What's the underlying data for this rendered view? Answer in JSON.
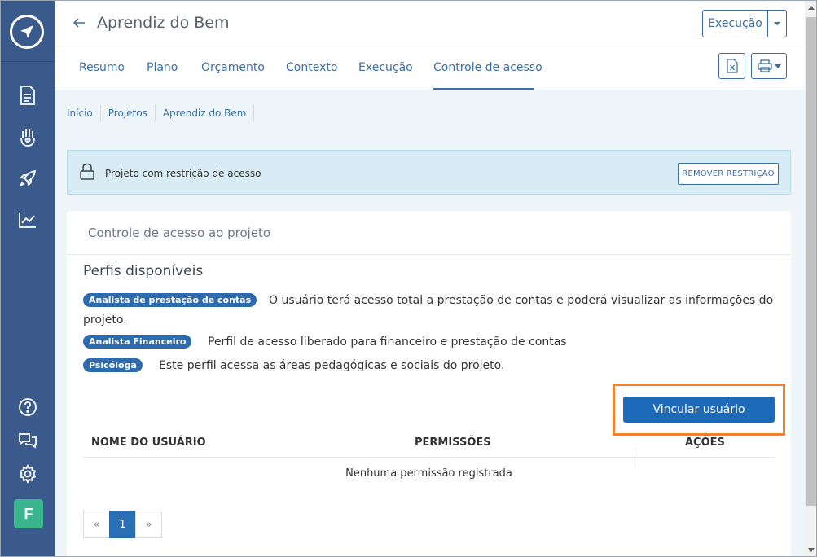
{
  "header": {
    "title": "Aprendiz do Bem",
    "execucao_label": "Execução"
  },
  "tabs": [
    {
      "label": "Resumo"
    },
    {
      "label": "Plano"
    },
    {
      "label": "Orçamento"
    },
    {
      "label": "Contexto"
    },
    {
      "label": "Execução"
    },
    {
      "label": "Controle de acesso",
      "active": true
    }
  ],
  "breadcrumb": [
    "Início",
    "Projetos",
    "Aprendiz do Bem"
  ],
  "alert": {
    "text": "Projeto com restrição de acesso",
    "remove_label": "REMOVER RESTRIÇÃO"
  },
  "card": {
    "title": "Controle de acesso ao projeto",
    "profiles_title": "Perfis disponíveis",
    "profiles": [
      {
        "name": "Analista de prestação de contas",
        "description_line1": "O usuário terá acesso total a prestação de contas e poderá visualizar as informações do",
        "description_line2": "projeto."
      },
      {
        "name": "Analista Financeiro",
        "description_line1": "Perfil de acesso liberado para financeiro e prestação de contas"
      },
      {
        "name": "Psicóloga",
        "description_line1": "Este perfil acessa as áreas pedagógicas e sociais do projeto."
      }
    ],
    "link_user_label": "Vincular usuário",
    "table": {
      "columns": [
        "NOME DO USUÁRIO",
        "PERMISSÕES",
        "AÇÕES"
      ],
      "empty_text": "Nenhuma permissão registrada"
    },
    "pagination": {
      "prev": "«",
      "current": "1",
      "next": "»"
    }
  },
  "user": {
    "initial": "F"
  },
  "colors": {
    "sidebar": "#3a5a8c",
    "accent": "#3a6ea5",
    "badge": "#2c6bb0",
    "primary_button": "#1c6ab8",
    "highlight": "#f4822b",
    "avatar": "#3bb58d",
    "alert_bg": "#d7ecf5"
  }
}
